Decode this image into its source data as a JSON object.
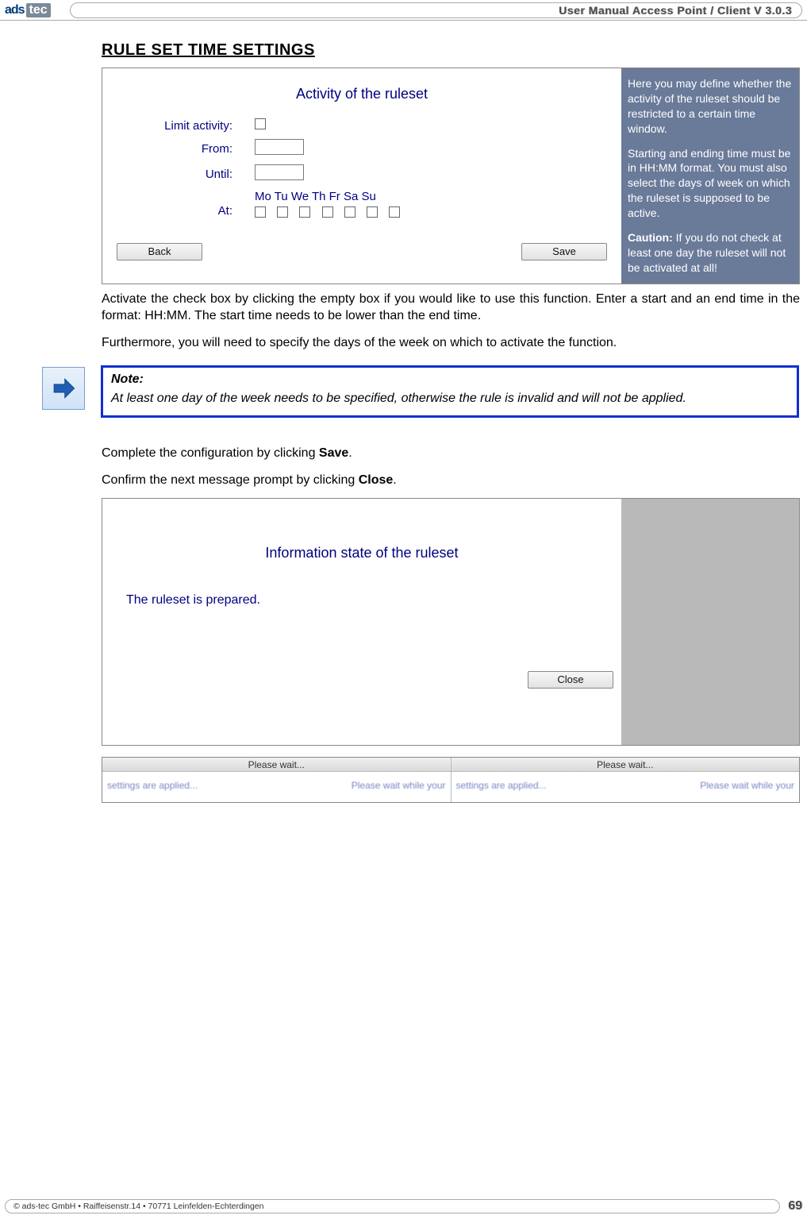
{
  "header": {
    "logo_left": "ads",
    "logo_right": "tec",
    "title": "User Manual Access  Point / Client V 3.0.3"
  },
  "section_heading": "RULE SET TIME SETTINGS",
  "screenshot1": {
    "title": "Activity of the ruleset",
    "labels": {
      "limit": "Limit activity:",
      "from": "From:",
      "until": "Until:",
      "at": "At:"
    },
    "days_header": "Mo Tu We Th  Fr  Sa Su",
    "buttons": {
      "back": "Back",
      "save": "Save"
    },
    "sidebar": {
      "p1": "Here you may define whether the activity of the ruleset should be restricted to a certain time window.",
      "p2": "Starting and ending time must be in HH:MM format. You must also select the days of week on which the ruleset is supposed to be active.",
      "caution_label": "Caution:",
      "caution_text": " If you do not check at least one day the ruleset will not be activated at all!"
    }
  },
  "para1": "Activate the check box by clicking the empty box if you would like to use this function. Enter a start and an end time in the format: HH:MM. The start time needs to be lower than the end time.",
  "para2": "Furthermore, you will need to specify the days of the week on which to activate the function.",
  "note": {
    "head": "Note:",
    "body": "At least one day of the week needs to be specified, otherwise the rule is invalid and will not be applied."
  },
  "para3_pre": "Complete the configuration by clicking ",
  "para3_bold": "Save",
  "para3_post": ".",
  "para4_pre": "Confirm the next message prompt by clicking ",
  "para4_bold": "Close",
  "para4_post": ".",
  "screenshot2": {
    "title": "Information state of the ruleset",
    "prepared": "The ruleset is prepared.",
    "close": "Close"
  },
  "wait": {
    "title": "Please wait...",
    "msg_left1": "settings are applied...",
    "msg_right1": "Please wait while your",
    "msg_left2": "settings are applied...",
    "msg_right2": "Please wait while your"
  },
  "footer": {
    "copyright": "© ads-tec GmbH • Raiffeisenstr.14 • 70771 Leinfelden-Echterdingen",
    "page": "69"
  }
}
